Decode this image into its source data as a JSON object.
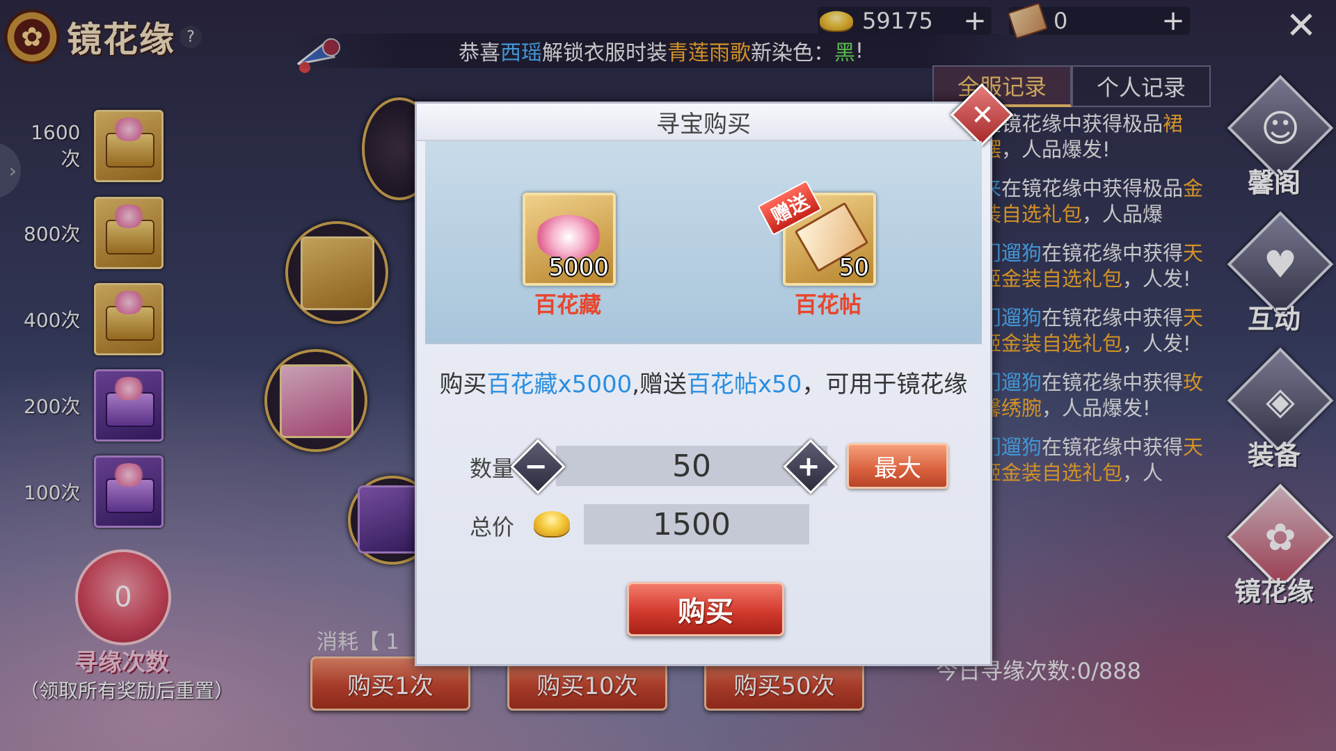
{
  "header": {
    "logo_title": "镜花缘",
    "help_icon": "question-icon",
    "gold_amount": "59175",
    "ticket_amount": "0",
    "close_icon": "close-icon"
  },
  "announcement": {
    "prefix": "恭喜",
    "player": "西瑶",
    "mid": "解锁衣服时装",
    "outfit": "青莲雨歌",
    "mid2": "新染色：",
    "color": "黑",
    "suffix": "!"
  },
  "tiers": [
    {
      "label": "1600次",
      "style": "gold"
    },
    {
      "label": "800次",
      "style": "gold"
    },
    {
      "label": "400次",
      "style": "gold"
    },
    {
      "label": "200次",
      "style": "purple"
    },
    {
      "label": "100次",
      "style": "purple"
    }
  ],
  "progress": {
    "count": "0",
    "title": "寻缘次数",
    "subtitle": "（领取所有奖励后重置）"
  },
  "consume_label": "消耗【 1",
  "buy_buttons": [
    "购买1次",
    "购买10次",
    "购买50次"
  ],
  "records": {
    "tabs": [
      "全服记录",
      "个人记录"
    ],
    "active_tab": 0,
    "entries": [
      {
        "a": "",
        "b": "在镜花缘中获得极品",
        "c": "裙摆",
        "d": "，人品爆发!"
      },
      {
        "a": "来",
        "b": "在镜花缘中获得极品",
        "c": "金装自选礼包",
        "d": "，人品爆"
      },
      {
        "a": "门遛狗",
        "b": "在镜花缘中获得",
        "c": "天姬金装自选礼包",
        "d": "，人发!"
      },
      {
        "a": "门遛狗",
        "b": "在镜花缘中获得",
        "c": "天姬金装自选礼包",
        "d": "，人发!"
      },
      {
        "a": "门遛狗",
        "b": "在镜花缘中获得",
        "c": "玫馨绣腕",
        "d": "，人品爆发!"
      },
      {
        "a": "门遛狗",
        "b": "在镜花缘中获得",
        "c": "天姬金装自选礼包",
        "d": "，人"
      }
    ],
    "today_count": "今日寻缘次数:0/888"
  },
  "nav": [
    {
      "label": "馨阁",
      "icon": "fox-mask-icon",
      "glyph": "☺",
      "active": false
    },
    {
      "label": "互动",
      "icon": "heart-hand-icon",
      "glyph": "♥",
      "active": false
    },
    {
      "label": "装备",
      "icon": "armor-icon",
      "glyph": "◈",
      "active": false
    },
    {
      "label": "镜花缘",
      "icon": "flower-icon",
      "glyph": "✿",
      "active": true
    }
  ],
  "modal": {
    "title": "寻宝购买",
    "rewards": [
      {
        "name": "百花藏",
        "qty": "5000",
        "icon": "flower-pile-icon",
        "gift": false
      },
      {
        "name": "百花帖",
        "qty": "50",
        "icon": "envelope-icon",
        "gift": true,
        "gift_label": "赠送"
      }
    ],
    "desc_prefix": "购买",
    "desc_item1": "百花藏x5000",
    "desc_mid": ",赠送",
    "desc_item2": "百花帖x50",
    "desc_suffix": "，可用于镜花缘",
    "quantity_label": "数量",
    "quantity_value": "50",
    "max_label": "最大",
    "total_label": "总价",
    "total_value": "1500",
    "buy_label": "购买"
  },
  "colors": {
    "accent_red": "#d23a2e",
    "highlight_blue": "#2a8ee0",
    "highlight_orange": "#ffb02b",
    "reward_name": "#e8452c"
  }
}
